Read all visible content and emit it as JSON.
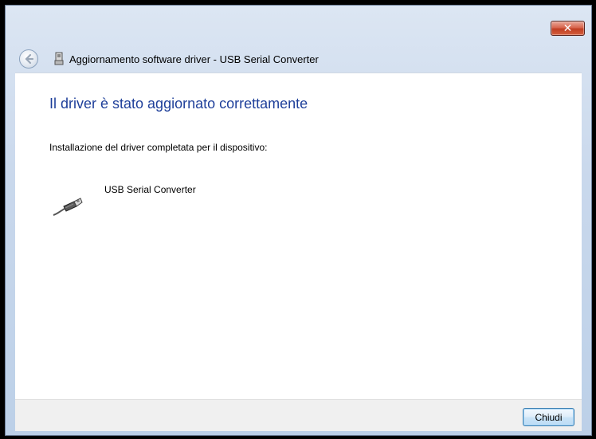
{
  "window": {
    "title": "Aggiornamento software driver - USB Serial Converter",
    "close_glyph": "✕"
  },
  "content": {
    "heading": "Il driver è stato aggiornato correttamente",
    "message": "Installazione del driver completata per il dispositivo:",
    "device_name": "USB Serial Converter"
  },
  "footer": {
    "close_label": "Chiudi"
  },
  "icons": {
    "back": "back-arrow-icon",
    "usb_small": "usb-connector-icon",
    "device": "usb-cable-icon"
  }
}
